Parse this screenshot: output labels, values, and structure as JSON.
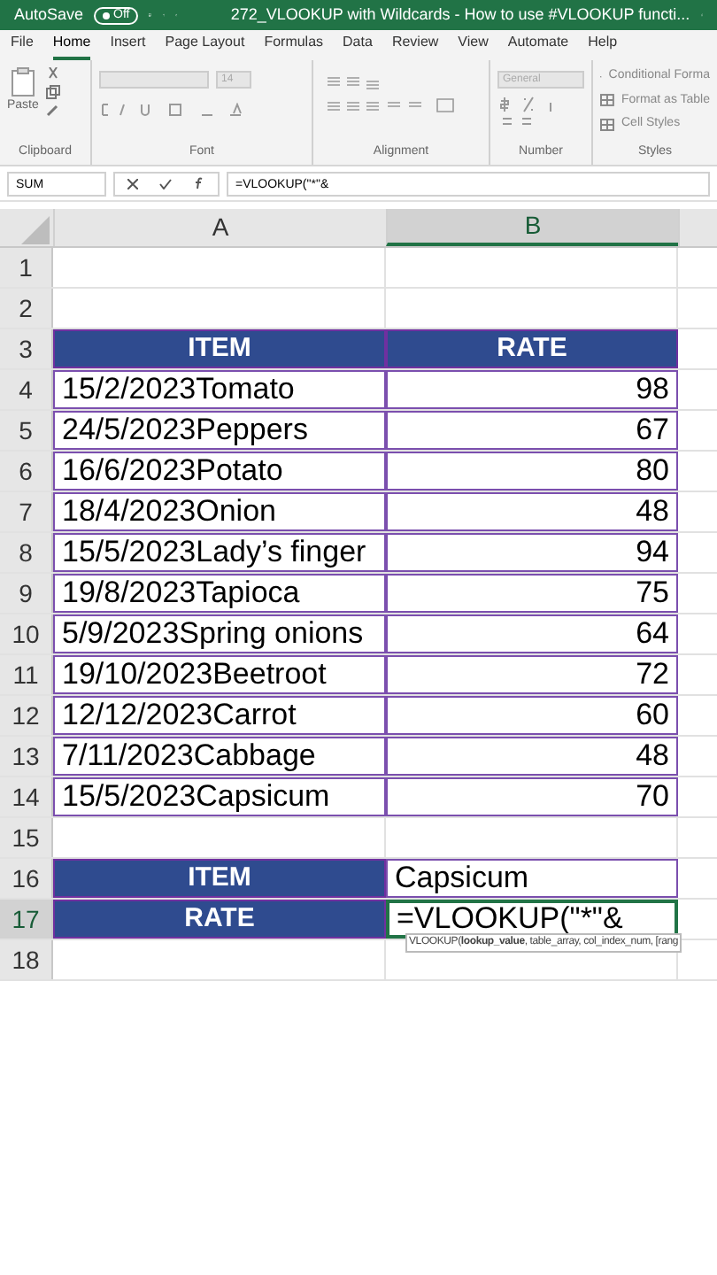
{
  "title_bar": {
    "autosave_label": "AutoSave",
    "autosave": {
      "label": "Off",
      "on": false
    },
    "title": "272_VLOOKUP with Wildcards - How to use #VLOOKUP functi..."
  },
  "menu_tabs": [
    {
      "label": "File",
      "selected": false
    },
    {
      "label": "Home",
      "selected": true
    },
    {
      "label": "Insert",
      "selected": false
    },
    {
      "label": "Page Layout",
      "selected": false
    },
    {
      "label": "Formulas",
      "selected": false
    },
    {
      "label": "Data",
      "selected": false
    },
    {
      "label": "Review",
      "selected": false
    },
    {
      "label": "View",
      "selected": false
    },
    {
      "label": "Automate",
      "selected": false
    },
    {
      "label": "Help",
      "selected": false
    }
  ],
  "ribbon": {
    "paste_label": "Paste",
    "font_size": "14",
    "number_format": "General",
    "styles": [
      "Conditional Forma",
      "Format as Table",
      "Cell Styles"
    ],
    "groups": [
      "Clipboard",
      "Font",
      "Alignment",
      "Number",
      "Styles"
    ]
  },
  "formula_bar": {
    "name_box": "SUM",
    "formula": "=VLOOKUP(\"*\"&"
  },
  "columns": [
    {
      "label": "A",
      "selected": false
    },
    {
      "label": "B",
      "selected": true
    }
  ],
  "rows": [
    {
      "number": "1",
      "selected": false,
      "cells": []
    },
    {
      "number": "2",
      "selected": false,
      "cells": []
    },
    {
      "number": "3",
      "selected": false,
      "cells": [
        {
          "text": "ITEM",
          "kind": "header"
        },
        {
          "text": "RATE",
          "kind": "header"
        }
      ]
    },
    {
      "number": "4",
      "selected": false,
      "cells": [
        {
          "text": "15/2/2023Tomato",
          "kind": "text"
        },
        {
          "text": "98",
          "kind": "number"
        }
      ]
    },
    {
      "number": "5",
      "selected": false,
      "cells": [
        {
          "text": "24/5/2023Peppers",
          "kind": "text"
        },
        {
          "text": "67",
          "kind": "number"
        }
      ]
    },
    {
      "number": "6",
      "selected": false,
      "cells": [
        {
          "text": "16/6/2023Potato",
          "kind": "text"
        },
        {
          "text": "80",
          "kind": "number"
        }
      ]
    },
    {
      "number": "7",
      "selected": false,
      "cells": [
        {
          "text": "18/4/2023Onion",
          "kind": "text"
        },
        {
          "text": "48",
          "kind": "number"
        }
      ]
    },
    {
      "number": "8",
      "selected": false,
      "cells": [
        {
          "text": "15/5/2023Lady’s finger",
          "kind": "text"
        },
        {
          "text": "94",
          "kind": "number"
        }
      ]
    },
    {
      "number": "9",
      "selected": false,
      "cells": [
        {
          "text": "19/8/2023Tapioca",
          "kind": "text"
        },
        {
          "text": "75",
          "kind": "number"
        }
      ]
    },
    {
      "number": "10",
      "selected": false,
      "cells": [
        {
          "text": "5/9/2023Spring onions",
          "kind": "text"
        },
        {
          "text": "64",
          "kind": "number"
        }
      ]
    },
    {
      "number": "11",
      "selected": false,
      "cells": [
        {
          "text": "19/10/2023Beetroot",
          "kind": "text"
        },
        {
          "text": "72",
          "kind": "number"
        }
      ]
    },
    {
      "number": "12",
      "selected": false,
      "cells": [
        {
          "text": "12/12/2023Carrot",
          "kind": "text"
        },
        {
          "text": "60",
          "kind": "number"
        }
      ]
    },
    {
      "number": "13",
      "selected": false,
      "cells": [
        {
          "text": "7/11/2023Cabbage",
          "kind": "text"
        },
        {
          "text": "48",
          "kind": "number"
        }
      ]
    },
    {
      "number": "14",
      "selected": false,
      "cells": [
        {
          "text": "15/5/2023Capsicum",
          "kind": "text"
        },
        {
          "text": "70",
          "kind": "number"
        }
      ]
    },
    {
      "number": "15",
      "selected": false,
      "cells": []
    },
    {
      "number": "16",
      "selected": false,
      "cells": [
        {
          "text": "ITEM",
          "kind": "header"
        },
        {
          "text": "Capsicum",
          "kind": "text"
        }
      ]
    },
    {
      "number": "17",
      "selected": true,
      "cells": [
        {
          "text": "RATE",
          "kind": "header"
        },
        {
          "text": "=VLOOKUP(\"*\"&",
          "kind": "editing"
        }
      ]
    },
    {
      "number": "18",
      "selected": false,
      "cells": []
    }
  ],
  "tooltip": "VLOOKUP(**lookup_value**, table_array, col_index_num, [rang"
}
